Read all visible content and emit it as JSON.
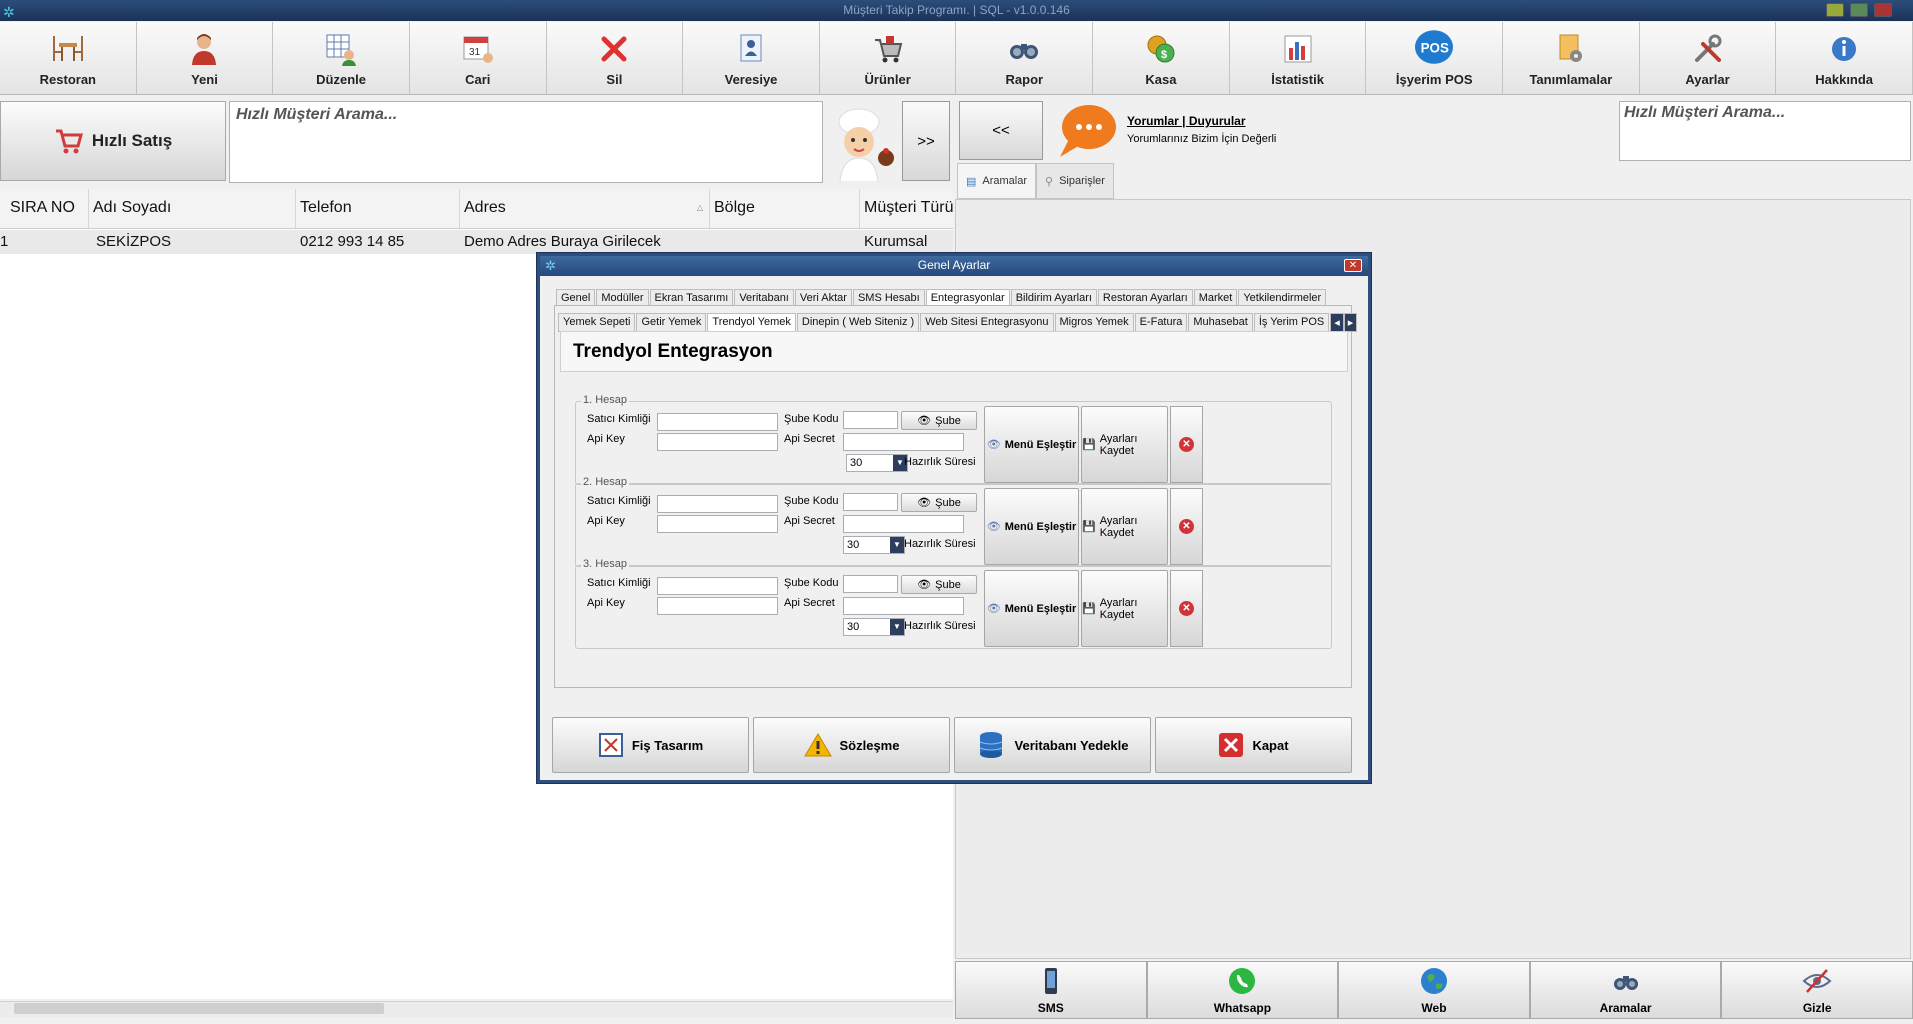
{
  "window": {
    "title": "Müşteri Takip Programı. | SQL - v1.0.0.146"
  },
  "toolbar": [
    {
      "label": "Restoran",
      "icon": "table-chairs-icon"
    },
    {
      "label": "Yeni",
      "icon": "user-icon"
    },
    {
      "label": "Düzenle",
      "icon": "edit-user-icon"
    },
    {
      "label": "Cari",
      "icon": "calendar-icon"
    },
    {
      "label": "Sil",
      "icon": "delete-x-icon"
    },
    {
      "label": "Veresiye",
      "icon": "id-card-icon"
    },
    {
      "label": "Ürünler",
      "icon": "cart-icon"
    },
    {
      "label": "Rapor",
      "icon": "binoculars-icon"
    },
    {
      "label": "Kasa",
      "icon": "coins-icon"
    },
    {
      "label": "İstatistik",
      "icon": "bar-chart-icon"
    },
    {
      "label": "İşyerim POS",
      "icon": "pos-badge-icon",
      "badge": "POS"
    },
    {
      "label": "Tanımlamalar",
      "icon": "settings-doc-icon"
    },
    {
      "label": "Ayarlar",
      "icon": "tools-icon"
    },
    {
      "label": "Hakkında",
      "icon": "info-icon"
    }
  ],
  "left": {
    "quick_sale": "Hızlı Satış",
    "search_placeholder": "Hızlı Müşteri Arama...",
    "next_label": ">>",
    "columns": [
      "SIRA NO",
      "Adı Soyadı",
      "Telefon",
      "Adres",
      "Bölge",
      "Müşteri Türü"
    ],
    "rows": [
      [
        "1",
        "SEKİZPOS",
        "0212 993 14 85",
        "Demo Adres Buraya Girilecek",
        "",
        "Kurumsal"
      ]
    ]
  },
  "right": {
    "back_label": "<<",
    "announce_title": "Yorumlar | Duyurular",
    "announce_sub": "Yorumlarınız Bizim İçin Değerli",
    "search_placeholder": "Hızlı Müşteri Arama...",
    "tabs": [
      {
        "label": "Aramalar",
        "active": true
      },
      {
        "label": "Siparişler",
        "active": false
      }
    ],
    "bottom": [
      {
        "label": "SMS",
        "icon": "phone-icon"
      },
      {
        "label": "Whatsapp",
        "icon": "whatsapp-icon"
      },
      {
        "label": "Web",
        "icon": "globe-icon"
      },
      {
        "label": "Aramalar",
        "icon": "binoculars-icon"
      },
      {
        "label": "Gizle",
        "icon": "hide-eye-icon"
      }
    ]
  },
  "dialog": {
    "title": "Genel Ayarlar",
    "tabs1": [
      "Genel",
      "Modüller",
      "Ekran Tasarımı",
      "Veritabanı",
      "Veri Aktar",
      "SMS Hesabı",
      "Entegrasyonlar",
      "Bildirim Ayarları",
      "Restoran Ayarları",
      "Market",
      "Yetkilendirmeler"
    ],
    "tabs1_active": "Entegrasyonlar",
    "tabs2": [
      "Yemek Sepeti",
      "Getir Yemek",
      "Trendyol Yemek",
      "Dinepin ( Web Siteniz )",
      "Web Sitesi Entegrasyonu",
      "Migros Yemek",
      "E-Fatura",
      "Muhasebat",
      "İş Yerim POS"
    ],
    "tabs2_active": "Trendyol Yemek",
    "header": "Trendyol Entegrasyon",
    "groups": [
      {
        "caption": "1. Hesap",
        "satici": "Satıcı Kimliği",
        "sube_kodu": "Şube Kodu",
        "sube_btn": "Şube",
        "api_key": "Api Key",
        "api_secret": "Api Secret",
        "hazirlik_value": "30",
        "hazirlik": "Hazırlık Süresi",
        "menu_btn": "Menü Eşleştir",
        "save_btn": "Ayarları Kaydet"
      },
      {
        "caption": "2. Hesap",
        "satici": "Satıcı Kimliği",
        "sube_kodu": "Şube Kodu",
        "sube_btn": "Şube",
        "api_key": "Api Key",
        "api_secret": "Api Secret",
        "hazirlik_value": "30",
        "hazirlik": "Hazırlık Süresi",
        "menu_btn": "Menü Eşleştir",
        "save_btn": "Ayarları Kaydet"
      },
      {
        "caption": "3. Hesap",
        "satici": "Satıcı Kimliği",
        "sube_kodu": "Şube Kodu",
        "sube_btn": "Şube",
        "api_key": "Api Key",
        "api_secret": "Api Secret",
        "hazirlik_value": "30",
        "hazirlik": "Hazırlık Süresi",
        "menu_btn": "Menü Eşleştir",
        "save_btn": "Ayarları Kaydet"
      }
    ],
    "footer": [
      {
        "label": "Fiş Tasarım",
        "icon": "receipt-design-icon"
      },
      {
        "label": "Sözleşme",
        "icon": "warning-icon"
      },
      {
        "label": "Veritabanı Yedekle",
        "icon": "database-icon"
      },
      {
        "label": "Kapat",
        "icon": "close-icon"
      }
    ]
  },
  "colors": {
    "accent": "#2e4e7e",
    "delete": "#d0343a",
    "bubble": "#f07a1e"
  }
}
